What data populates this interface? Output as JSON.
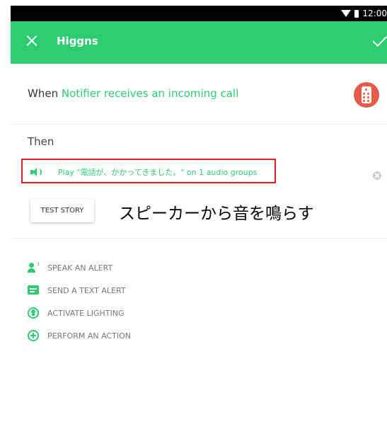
{
  "status_bar": {
    "time": "12:00"
  },
  "app_bar": {
    "title": "Higgns"
  },
  "when": {
    "prefix": "When",
    "trigger": "Notifier receives an incoming call"
  },
  "then": {
    "label": "Then",
    "action": "Play \"電話が、かかってきました。\" on 1 audio groups",
    "test_button": "TEST STORY"
  },
  "annotation": "スピーカーから音を鳴らす",
  "add_actions": [
    {
      "label": "SPEAK AN ALERT",
      "icon": "speak-icon"
    },
    {
      "label": "SEND A TEXT ALERT",
      "icon": "message-icon"
    },
    {
      "label": "ACTIVATE LIGHTING",
      "icon": "lightbulb-icon"
    },
    {
      "label": "PERFORM AN ACTION",
      "icon": "add-circle-icon"
    }
  ],
  "colors": {
    "accent": "#2ecc71",
    "highlight_border": "#e02020",
    "device_icon": "#e65a4a"
  }
}
